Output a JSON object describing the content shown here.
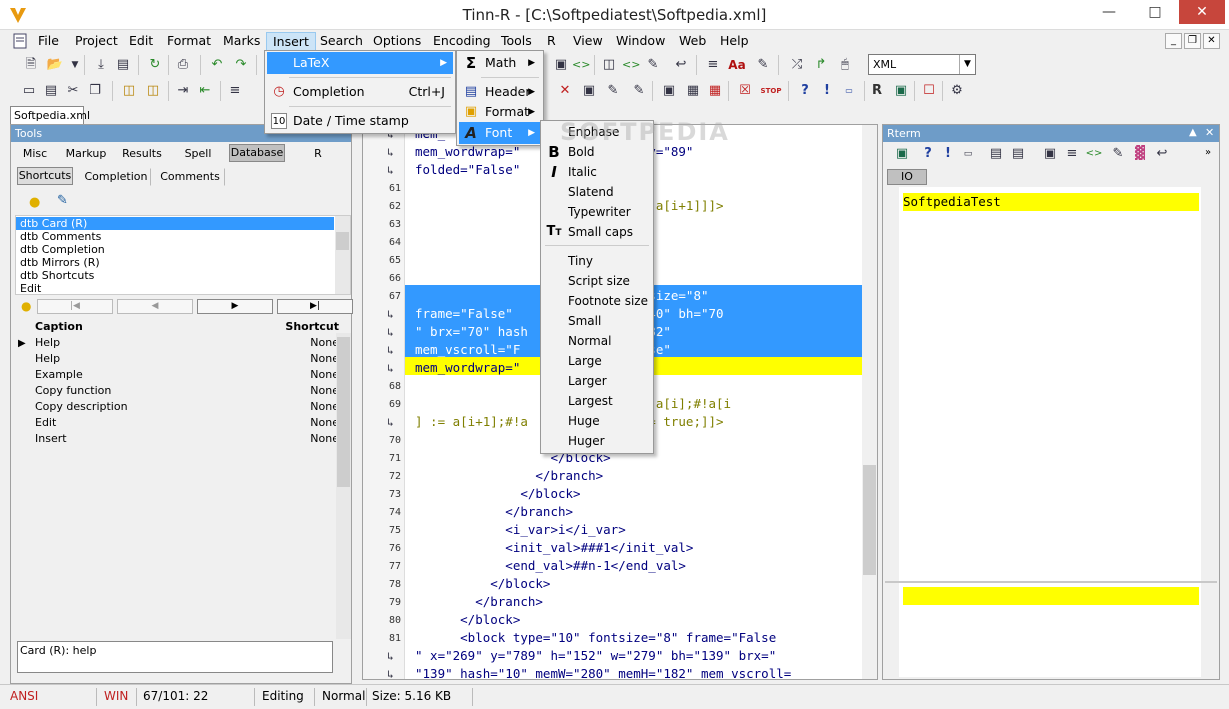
{
  "window": {
    "title": "Tinn-R - [C:\\Softpediatest\\Softpedia.xml]"
  },
  "menubar": [
    "File",
    "Project",
    "Edit",
    "Format",
    "Marks",
    "Insert",
    "Search",
    "Options",
    "Encoding",
    "Tools",
    "R",
    "View",
    "Window",
    "Web",
    "Help"
  ],
  "toolbar": {
    "combo_value": "XML"
  },
  "file_tab": "Softpedia.xml",
  "tools": {
    "title": "Tools",
    "tabs": [
      "Misc",
      "Markup",
      "Results",
      "Spell",
      "Database",
      "R"
    ],
    "subtabs": [
      "Shortcuts",
      "Completion",
      "Comments"
    ],
    "list": [
      "dtb Card (R)",
      "dtb Comments",
      "dtb Completion",
      "dtb Mirrors (R)",
      "dtb Shortcuts",
      "Edit"
    ],
    "table_headers": {
      "caption": "Caption",
      "shortcut": "Shortcut"
    },
    "rows": [
      {
        "caption": "Help",
        "shortcut": "None"
      },
      {
        "caption": "Help",
        "shortcut": "None"
      },
      {
        "caption": "Example",
        "shortcut": "None"
      },
      {
        "caption": "Copy function",
        "shortcut": "None"
      },
      {
        "caption": "Copy description",
        "shortcut": "None"
      },
      {
        "caption": "Edit",
        "shortcut": "None"
      },
      {
        "caption": "Insert",
        "shortcut": "None"
      }
    ],
    "footer_text": "Card (R): help"
  },
  "editor": {
    "lines": [
      {
        "n": "",
        "t": "mem_               croll=\"False\""
      },
      {
        "n": "",
        "t": "mem_wordwrap=\"    0\" fh=\"91\" bry=\"89\""
      },
      {
        "n": "",
        "t": "folded=\"False\""
      },
      {
        "n": "61",
        "t": ""
      },
      {
        "n": "62",
        "t": "                       A[a[i] > a[i+1]]]>"
      },
      {
        "n": "63",
        "t": ""
      },
      {
        "n": "64",
        "t": ""
      },
      {
        "n": "65",
        "t": "                          x>"
      },
      {
        "n": "66",
        "t": "                         >"
      },
      {
        "n": "67",
        "t": "                  type=\"2\" fontsize=\"8\""
      },
      {
        "n": "",
        "t": "frame=\"False\"       h=\"91\" w=\"140\" bh=\"70"
      },
      {
        "n": "",
        "t": "\" brx=\"70\" hash      0\" memH=\"182\""
      },
      {
        "n": "",
        "t": "mem_vscroll=\"F      scroll=\"False\""
      },
      {
        "n": "",
        "t": "mem_wordwrap=\""
      },
      {
        "n": "68",
        "t": ""
      },
      {
        "n": "69",
        "t": "                   CDATA[buf := a[i];#!a[i"
      },
      {
        "n": "",
        "t": "] := a[i+1];#!a      #!change := true;]]>"
      },
      {
        "n": "70",
        "t": "                        >"
      },
      {
        "n": "71",
        "t": "                  </block>"
      },
      {
        "n": "72",
        "t": "                </branch>"
      },
      {
        "n": "73",
        "t": "              </block>"
      },
      {
        "n": "74",
        "t": "            </branch>"
      },
      {
        "n": "75",
        "t": "            <i_var>i</i_var>"
      },
      {
        "n": "76",
        "t": "            <init_val>###1</init_val>"
      },
      {
        "n": "77",
        "t": "            <end_val>##n-1</end_val>"
      },
      {
        "n": "78",
        "t": "          </block>"
      },
      {
        "n": "79",
        "t": "        </branch>"
      },
      {
        "n": "80",
        "t": "      </block>"
      },
      {
        "n": "81",
        "t": "      <block type=\"10\" fontsize=\"8\" frame=\"False"
      },
      {
        "n": "",
        "t": "\" x=\"269\" y=\"789\" h=\"152\" w=\"279\" bh=\"139\" brx=\""
      },
      {
        "n": "",
        "t": "\"139\" hash=\"10\" memW=\"280\" memH=\"182\" mem_vscroll="
      }
    ]
  },
  "rterm": {
    "title": "Rterm",
    "tab": "IO",
    "output": "SoftpediaTest"
  },
  "insert_menu": [
    {
      "label": "LaTeX",
      "shortcut": "",
      "sub": true
    },
    {
      "label": "Completion",
      "shortcut": "Ctrl+J",
      "sub": false
    },
    {
      "label": "Date / Time stamp",
      "shortcut": "",
      "sub": false
    }
  ],
  "latex_menu": [
    "Math",
    "Header",
    "Format",
    "Font"
  ],
  "font_menu": {
    "group1": [
      "Enphase",
      "Bold",
      "Italic",
      "Slatend",
      "Typewriter",
      "Small caps"
    ],
    "group2": [
      "Tiny",
      "Script size",
      "Footnote size",
      "Small",
      "Normal",
      "Large",
      "Larger",
      "Largest",
      "Huge",
      "Huger"
    ]
  },
  "status": {
    "encoding": "ANSI",
    "eol": "WIN",
    "position": "67/101: 22",
    "mode": "Editing",
    "view": "Normal",
    "size": "Size: 5.16 KB"
  },
  "watermark": "SOFTPEDIA"
}
